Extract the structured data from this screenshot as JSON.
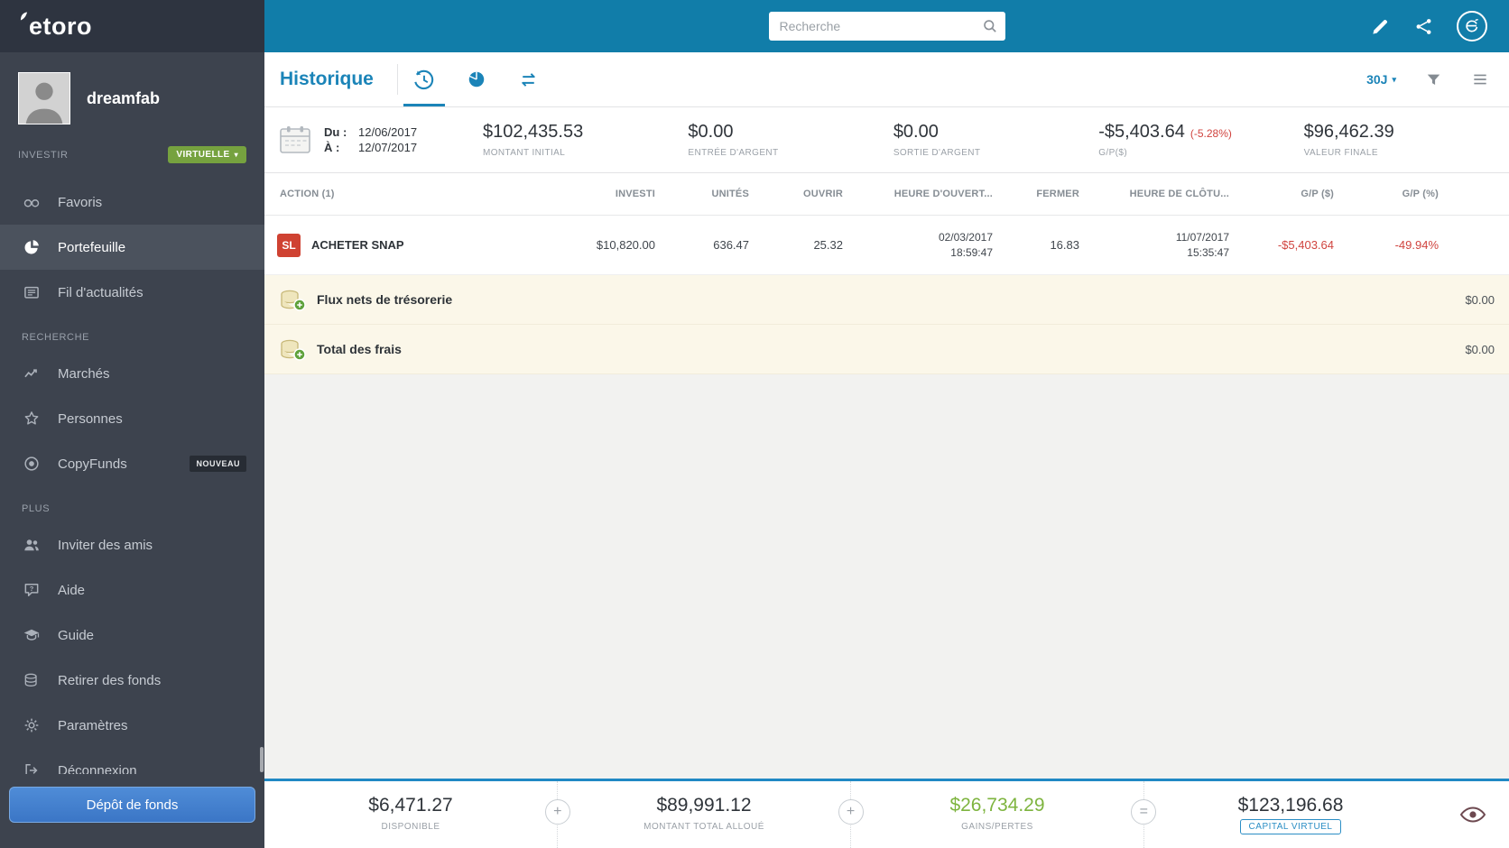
{
  "colors": {
    "header_teal": "#117da9",
    "accent_blue": "#1b84b8",
    "negative_red": "#d0443f",
    "positive_green": "#7eb43f",
    "sidebar_dark": "#3d434e",
    "virtual_badge_green": "#76a23f",
    "stop_loss_red": "#cf4232"
  },
  "header": {
    "logo_text": "etoro",
    "search_placeholder": "Recherche"
  },
  "sidebar": {
    "username": "dreamfab",
    "invest_label": "INVESTIR",
    "mode_badge": "VIRTUELLE",
    "section_headers": [
      "RECHERCHE",
      "PLUS"
    ],
    "nav": [
      {
        "label": "Favoris",
        "icon": "binoculars"
      },
      {
        "label": "Portefeuille",
        "icon": "pie-chart"
      },
      {
        "label": "Fil d'actualités",
        "icon": "news-feed"
      },
      {
        "label": "Marchés",
        "icon": "trend-chart"
      },
      {
        "label": "Personnes",
        "icon": "star"
      },
      {
        "label": "CopyFunds",
        "icon": "target",
        "badge": "NOUVEAU"
      },
      {
        "label": "Inviter des amis",
        "icon": "people"
      },
      {
        "label": "Aide",
        "icon": "help-bubble"
      },
      {
        "label": "Guide",
        "icon": "graduation-cap"
      },
      {
        "label": "Retirer des fonds",
        "icon": "coins"
      },
      {
        "label": "Paramètres",
        "icon": "gear"
      },
      {
        "label": "Déconnexion",
        "icon": "logout"
      }
    ],
    "deposit_button": "Dépôt de fonds"
  },
  "toolbar": {
    "title": "Historique",
    "period": "30J"
  },
  "summary": {
    "from_label": "Du :",
    "from_value": "12/06/2017",
    "to_label": "À :",
    "to_value": "12/07/2017",
    "stats": [
      {
        "value": "$102,435.53",
        "label": "MONTANT INITIAL"
      },
      {
        "value": "$0.00",
        "label": "ENTRÉE D'ARGENT"
      },
      {
        "value": "$0.00",
        "label": "SORTIE D'ARGENT"
      },
      {
        "value": "-$5,403.64",
        "pct": "(-5.28%)",
        "label": "G/P($)"
      },
      {
        "value": "$96,462.39",
        "label": "VALEUR FINALE"
      }
    ]
  },
  "table": {
    "headers": [
      "ACTION (1)",
      "INVESTI",
      "UNITÉS",
      "OUVRIR",
      "HEURE D'OUVERT...",
      "FERMER",
      "HEURE DE CLÔTU...",
      "G/P ($)",
      "G/P (%)"
    ],
    "rows": [
      {
        "badge": "SL",
        "action": "ACHETER SNAP",
        "invested": "$10,820.00",
        "units": "636.47",
        "open_rate": "25.32",
        "open_date": "02/03/2017",
        "open_time": "18:59:47",
        "close_rate": "16.83",
        "close_date": "11/07/2017",
        "close_time": "15:35:47",
        "gp_usd": "-$5,403.64",
        "gp_pct": "-49.94%"
      }
    ],
    "summary_rows": [
      {
        "label": "Flux nets de trésorerie",
        "value": "$0.00"
      },
      {
        "label": "Total des frais",
        "value": "$0.00"
      }
    ]
  },
  "footer": {
    "stats": [
      {
        "value": "$6,471.27",
        "label": "DISPONIBLE"
      },
      {
        "value": "$89,991.12",
        "label": "MONTANT TOTAL ALLOUÉ"
      },
      {
        "value": "$26,734.29",
        "label": "GAINS/PERTES"
      },
      {
        "value": "$123,196.68",
        "label": "CAPITAL VIRTUEL"
      }
    ],
    "operators": [
      "+",
      "+",
      "="
    ]
  }
}
